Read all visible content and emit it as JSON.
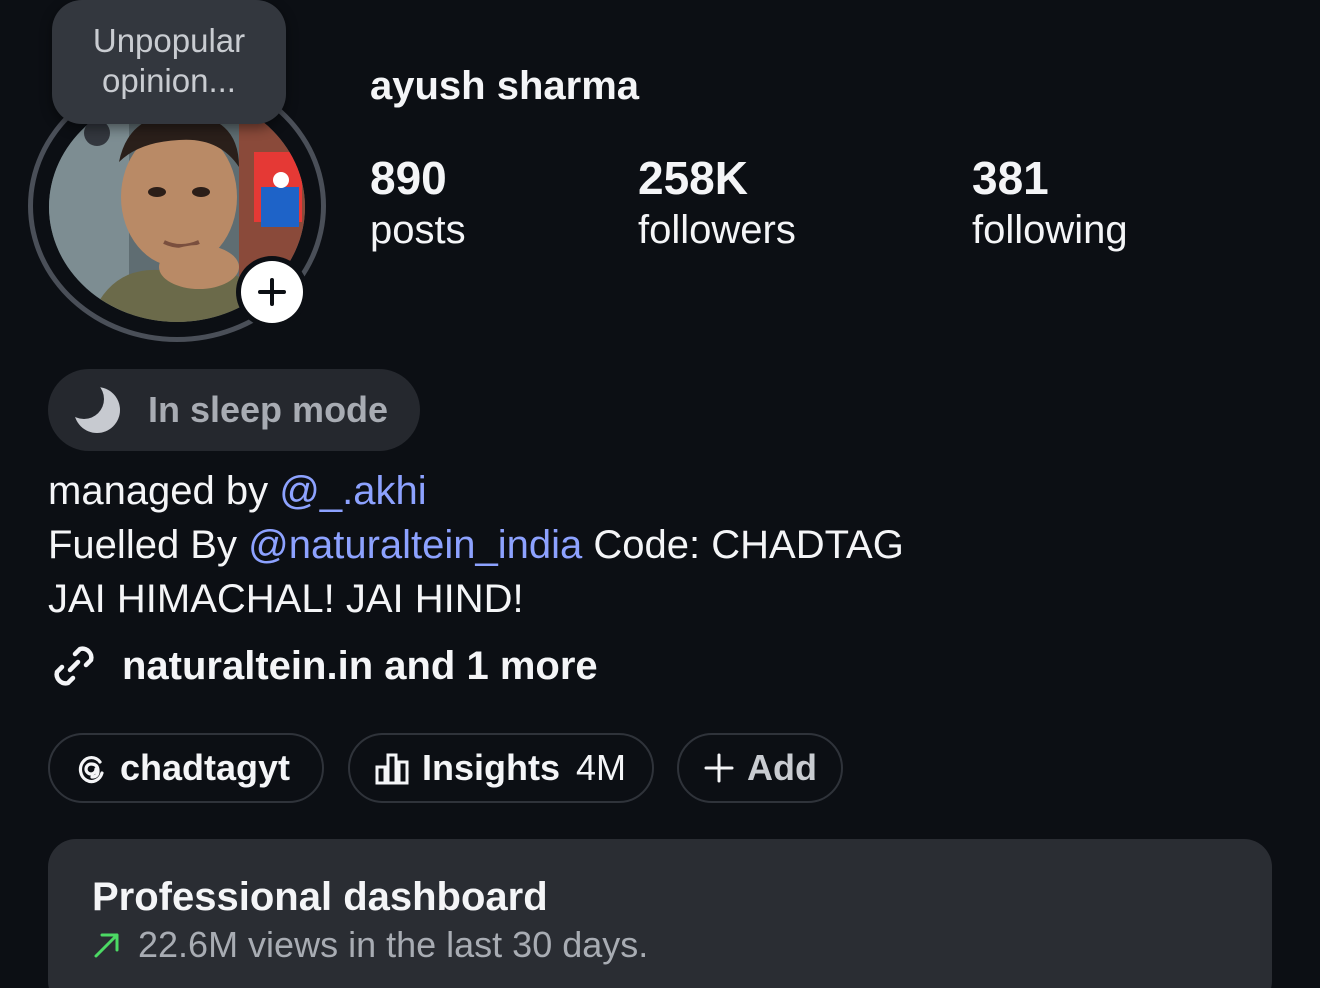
{
  "note": {
    "text": "Unpopular opinion..."
  },
  "profile": {
    "username": "ayush sharma",
    "stats": [
      {
        "value": "890",
        "label": "posts"
      },
      {
        "value": "258K",
        "label": "followers"
      },
      {
        "value": "381",
        "label": "following"
      }
    ]
  },
  "status": {
    "icon": "moon-icon",
    "text": "In sleep mode"
  },
  "bio": {
    "line1_prefix": "managed by ",
    "line1_mention": "@_.akhi",
    "line2_prefix": "Fuelled By ",
    "line2_mention": "@naturaltein_india",
    "line2_suffix": " Code: CHADTAG",
    "line3": "JAI HIMACHAL! JAI HIND!"
  },
  "links": {
    "icon": "link-icon",
    "text": "naturaltein.in and 1 more"
  },
  "chips": {
    "threads": {
      "icon": "threads-icon",
      "label": "chadtagyt"
    },
    "insights": {
      "icon": "bar-chart-icon",
      "label": "Insights",
      "value": "4M"
    },
    "add": {
      "icon": "plus-icon",
      "label": "Add"
    }
  },
  "dashboard": {
    "title": "Professional dashboard",
    "icon": "trend-up-icon",
    "subtitle": "22.6M views in the last 30 days."
  },
  "colors": {
    "background": "#0c0f14",
    "mention": "#8da2ff",
    "trend": "#4cd964",
    "card": "#2a2d33"
  }
}
